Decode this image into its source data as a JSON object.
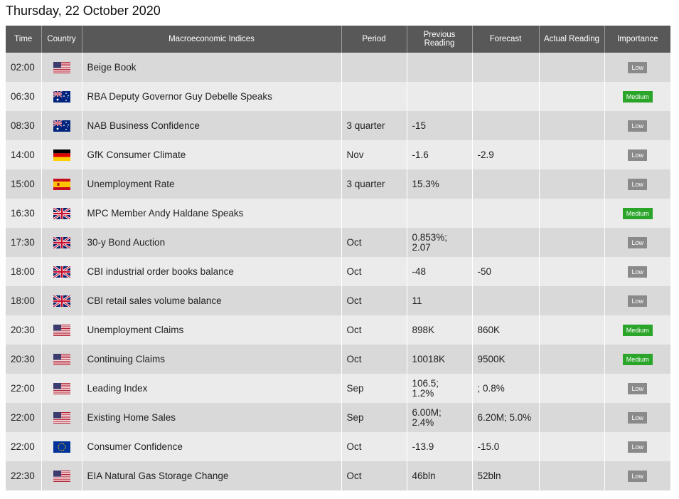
{
  "page": {
    "date_title": "Thursday, 22 October 2020"
  },
  "table": {
    "headers": {
      "time": "Time",
      "country": "Country",
      "index": "Macroeconomic Indices",
      "period": "Period",
      "previous": "Previous Reading",
      "forecast": "Forecast",
      "actual": "Actual Reading",
      "importance": "Importance"
    },
    "rows": [
      {
        "time": "02:00",
        "flag": "us-flag-icon",
        "index": "Beige Book",
        "period": "",
        "previous": "",
        "forecast": "",
        "actual": "",
        "importance": "Low"
      },
      {
        "time": "06:30",
        "flag": "au-flag-icon",
        "index": "RBA Deputy Governor Guy Debelle Speaks",
        "period": "",
        "previous": "",
        "forecast": "",
        "actual": "",
        "importance": "Medium"
      },
      {
        "time": "08:30",
        "flag": "au-flag-icon",
        "index": "NAB Business Confidence",
        "period": "3 quarter",
        "previous": "-15",
        "forecast": "",
        "actual": "",
        "importance": "Low"
      },
      {
        "time": "14:00",
        "flag": "de-flag-icon",
        "index": "GfK Consumer Climate",
        "period": "Nov",
        "previous": "-1.6",
        "forecast": "-2.9",
        "actual": "",
        "importance": "Low"
      },
      {
        "time": "15:00",
        "flag": "es-flag-icon",
        "index": "Unemployment Rate",
        "period": "3 quarter",
        "previous": "15.3%",
        "forecast": "",
        "actual": "",
        "importance": "Low"
      },
      {
        "time": "16:30",
        "flag": "uk-flag-icon",
        "index": "MPC Member Andy Haldane Speaks",
        "period": "",
        "previous": "",
        "forecast": "",
        "actual": "",
        "importance": "Medium"
      },
      {
        "time": "17:30",
        "flag": "uk-flag-icon",
        "index": "30-y Bond Auction",
        "period": "Oct",
        "previous": "0.853%; 2.07",
        "forecast": "",
        "actual": "",
        "importance": "Low"
      },
      {
        "time": "18:00",
        "flag": "uk-flag-icon",
        "index": "CBI industrial order books balance",
        "period": "Oct",
        "previous": "-48",
        "forecast": "-50",
        "actual": "",
        "importance": "Low"
      },
      {
        "time": "18:00",
        "flag": "uk-flag-icon",
        "index": "CBI retail sales volume balance",
        "period": "Oct",
        "previous": "11",
        "forecast": "",
        "actual": "",
        "importance": "Low"
      },
      {
        "time": "20:30",
        "flag": "us-flag-icon",
        "index": "Unemployment Claims",
        "period": "Oct",
        "previous": "898K",
        "forecast": "860K",
        "actual": "",
        "importance": "Medium"
      },
      {
        "time": "20:30",
        "flag": "us-flag-icon",
        "index": "Continuing Claims",
        "period": "Oct",
        "previous": "10018K",
        "forecast": "9500K",
        "actual": "",
        "importance": "Medium"
      },
      {
        "time": "22:00",
        "flag": "us-flag-icon",
        "index": "Leading Index",
        "period": "Sep",
        "previous": "106.5; 1.2%",
        "forecast": "; 0.8%",
        "actual": "",
        "importance": "Low"
      },
      {
        "time": "22:00",
        "flag": "us-flag-icon",
        "index": "Existing Home Sales",
        "period": "Sep",
        "previous": "6.00M; 2.4%",
        "forecast": "6.20M; 5.0%",
        "actual": "",
        "importance": "Low"
      },
      {
        "time": "22:00",
        "flag": "eu-flag-icon",
        "index": "Consumer Confidence",
        "period": "Oct",
        "previous": "-13.9",
        "forecast": "-15.0",
        "actual": "",
        "importance": "Low"
      },
      {
        "time": "22:30",
        "flag": "us-flag-icon",
        "index": "EIA Natural Gas Storage Change",
        "period": "Oct",
        "previous": "46bln",
        "forecast": "52bln",
        "actual": "",
        "importance": "Low"
      }
    ]
  },
  "colors": {
    "header_bg": "#585858",
    "row_odd": "#d9d9d9",
    "row_even": "#ebebeb",
    "badge_low": "#8a8a8a",
    "badge_medium": "#2aa52a"
  }
}
